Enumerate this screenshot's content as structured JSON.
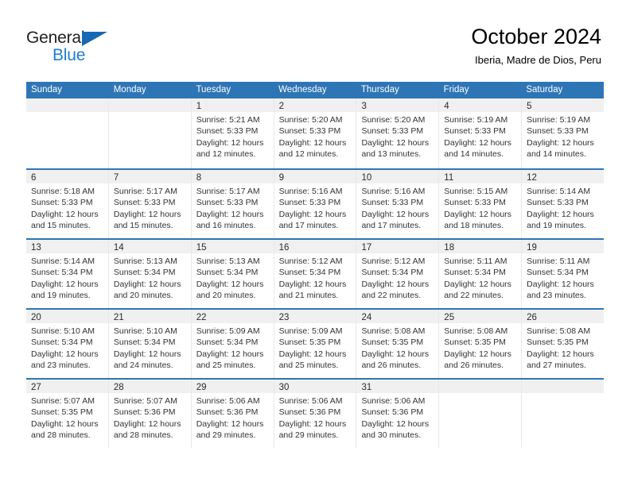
{
  "logo": {
    "text_top": "General",
    "text_bottom": "Blue",
    "triangle_color": "#1668b3",
    "blue_color": "#1d7dd1"
  },
  "header": {
    "title": "October 2024",
    "subtitle": "Iberia, Madre de Dios, Peru"
  },
  "theme": {
    "header_blue": "#2e75b6",
    "daynum_band": "#f0f0f0",
    "cell_border": "#e8e8e8"
  },
  "weekdays": [
    "Sunday",
    "Monday",
    "Tuesday",
    "Wednesday",
    "Thursday",
    "Friday",
    "Saturday"
  ],
  "weeks": [
    {
      "days": [
        {
          "num": "",
          "l1": "",
          "l2": "",
          "l3": "",
          "l4": ""
        },
        {
          "num": "",
          "l1": "",
          "l2": "",
          "l3": "",
          "l4": ""
        },
        {
          "num": "1",
          "l1": "Sunrise: 5:21 AM",
          "l2": "Sunset: 5:33 PM",
          "l3": "Daylight: 12 hours",
          "l4": "and 12 minutes."
        },
        {
          "num": "2",
          "l1": "Sunrise: 5:20 AM",
          "l2": "Sunset: 5:33 PM",
          "l3": "Daylight: 12 hours",
          "l4": "and 12 minutes."
        },
        {
          "num": "3",
          "l1": "Sunrise: 5:20 AM",
          "l2": "Sunset: 5:33 PM",
          "l3": "Daylight: 12 hours",
          "l4": "and 13 minutes."
        },
        {
          "num": "4",
          "l1": "Sunrise: 5:19 AM",
          "l2": "Sunset: 5:33 PM",
          "l3": "Daylight: 12 hours",
          "l4": "and 14 minutes."
        },
        {
          "num": "5",
          "l1": "Sunrise: 5:19 AM",
          "l2": "Sunset: 5:33 PM",
          "l3": "Daylight: 12 hours",
          "l4": "and 14 minutes."
        }
      ]
    },
    {
      "days": [
        {
          "num": "6",
          "l1": "Sunrise: 5:18 AM",
          "l2": "Sunset: 5:33 PM",
          "l3": "Daylight: 12 hours",
          "l4": "and 15 minutes."
        },
        {
          "num": "7",
          "l1": "Sunrise: 5:17 AM",
          "l2": "Sunset: 5:33 PM",
          "l3": "Daylight: 12 hours",
          "l4": "and 15 minutes."
        },
        {
          "num": "8",
          "l1": "Sunrise: 5:17 AM",
          "l2": "Sunset: 5:33 PM",
          "l3": "Daylight: 12 hours",
          "l4": "and 16 minutes."
        },
        {
          "num": "9",
          "l1": "Sunrise: 5:16 AM",
          "l2": "Sunset: 5:33 PM",
          "l3": "Daylight: 12 hours",
          "l4": "and 17 minutes."
        },
        {
          "num": "10",
          "l1": "Sunrise: 5:16 AM",
          "l2": "Sunset: 5:33 PM",
          "l3": "Daylight: 12 hours",
          "l4": "and 17 minutes."
        },
        {
          "num": "11",
          "l1": "Sunrise: 5:15 AM",
          "l2": "Sunset: 5:33 PM",
          "l3": "Daylight: 12 hours",
          "l4": "and 18 minutes."
        },
        {
          "num": "12",
          "l1": "Sunrise: 5:14 AM",
          "l2": "Sunset: 5:33 PM",
          "l3": "Daylight: 12 hours",
          "l4": "and 19 minutes."
        }
      ]
    },
    {
      "days": [
        {
          "num": "13",
          "l1": "Sunrise: 5:14 AM",
          "l2": "Sunset: 5:34 PM",
          "l3": "Daylight: 12 hours",
          "l4": "and 19 minutes."
        },
        {
          "num": "14",
          "l1": "Sunrise: 5:13 AM",
          "l2": "Sunset: 5:34 PM",
          "l3": "Daylight: 12 hours",
          "l4": "and 20 minutes."
        },
        {
          "num": "15",
          "l1": "Sunrise: 5:13 AM",
          "l2": "Sunset: 5:34 PM",
          "l3": "Daylight: 12 hours",
          "l4": "and 20 minutes."
        },
        {
          "num": "16",
          "l1": "Sunrise: 5:12 AM",
          "l2": "Sunset: 5:34 PM",
          "l3": "Daylight: 12 hours",
          "l4": "and 21 minutes."
        },
        {
          "num": "17",
          "l1": "Sunrise: 5:12 AM",
          "l2": "Sunset: 5:34 PM",
          "l3": "Daylight: 12 hours",
          "l4": "and 22 minutes."
        },
        {
          "num": "18",
          "l1": "Sunrise: 5:11 AM",
          "l2": "Sunset: 5:34 PM",
          "l3": "Daylight: 12 hours",
          "l4": "and 22 minutes."
        },
        {
          "num": "19",
          "l1": "Sunrise: 5:11 AM",
          "l2": "Sunset: 5:34 PM",
          "l3": "Daylight: 12 hours",
          "l4": "and 23 minutes."
        }
      ]
    },
    {
      "days": [
        {
          "num": "20",
          "l1": "Sunrise: 5:10 AM",
          "l2": "Sunset: 5:34 PM",
          "l3": "Daylight: 12 hours",
          "l4": "and 23 minutes."
        },
        {
          "num": "21",
          "l1": "Sunrise: 5:10 AM",
          "l2": "Sunset: 5:34 PM",
          "l3": "Daylight: 12 hours",
          "l4": "and 24 minutes."
        },
        {
          "num": "22",
          "l1": "Sunrise: 5:09 AM",
          "l2": "Sunset: 5:34 PM",
          "l3": "Daylight: 12 hours",
          "l4": "and 25 minutes."
        },
        {
          "num": "23",
          "l1": "Sunrise: 5:09 AM",
          "l2": "Sunset: 5:35 PM",
          "l3": "Daylight: 12 hours",
          "l4": "and 25 minutes."
        },
        {
          "num": "24",
          "l1": "Sunrise: 5:08 AM",
          "l2": "Sunset: 5:35 PM",
          "l3": "Daylight: 12 hours",
          "l4": "and 26 minutes."
        },
        {
          "num": "25",
          "l1": "Sunrise: 5:08 AM",
          "l2": "Sunset: 5:35 PM",
          "l3": "Daylight: 12 hours",
          "l4": "and 26 minutes."
        },
        {
          "num": "26",
          "l1": "Sunrise: 5:08 AM",
          "l2": "Sunset: 5:35 PM",
          "l3": "Daylight: 12 hours",
          "l4": "and 27 minutes."
        }
      ]
    },
    {
      "days": [
        {
          "num": "27",
          "l1": "Sunrise: 5:07 AM",
          "l2": "Sunset: 5:35 PM",
          "l3": "Daylight: 12 hours",
          "l4": "and 28 minutes."
        },
        {
          "num": "28",
          "l1": "Sunrise: 5:07 AM",
          "l2": "Sunset: 5:36 PM",
          "l3": "Daylight: 12 hours",
          "l4": "and 28 minutes."
        },
        {
          "num": "29",
          "l1": "Sunrise: 5:06 AM",
          "l2": "Sunset: 5:36 PM",
          "l3": "Daylight: 12 hours",
          "l4": "and 29 minutes."
        },
        {
          "num": "30",
          "l1": "Sunrise: 5:06 AM",
          "l2": "Sunset: 5:36 PM",
          "l3": "Daylight: 12 hours",
          "l4": "and 29 minutes."
        },
        {
          "num": "31",
          "l1": "Sunrise: 5:06 AM",
          "l2": "Sunset: 5:36 PM",
          "l3": "Daylight: 12 hours",
          "l4": "and 30 minutes."
        },
        {
          "num": "",
          "l1": "",
          "l2": "",
          "l3": "",
          "l4": ""
        },
        {
          "num": "",
          "l1": "",
          "l2": "",
          "l3": "",
          "l4": ""
        }
      ]
    }
  ]
}
